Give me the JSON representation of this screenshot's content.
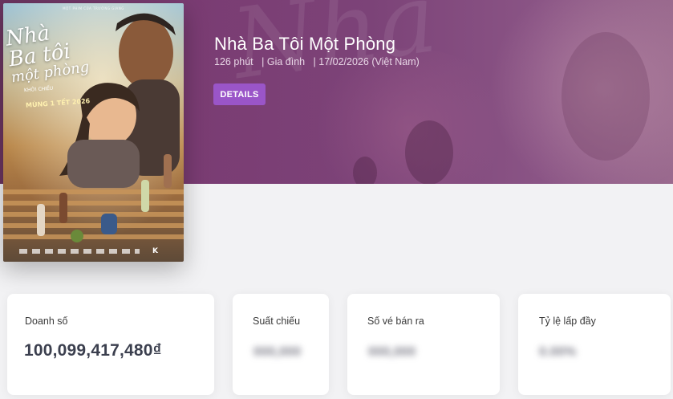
{
  "movie": {
    "title": "Nhà Ba Tôi Một Phòng",
    "duration": "126 phút",
    "genre": "Gia đình",
    "release": "17/02/2026 (Việt Nam)",
    "details_label": "DETAILS"
  },
  "poster": {
    "title_line1": "Nhà",
    "title_line2": "Ba tôi",
    "title_line3": "một phòng",
    "credits": "MỘT PHIM CỦA TRƯỜNG GIANG",
    "subtitle": "KHỞI CHIẾU",
    "date": "MÙNG 1 TẾT 2026",
    "logo": "K"
  },
  "stats": [
    {
      "label": "Doanh số",
      "value": "100,099,417,480₫"
    },
    {
      "label": "Suất chiếu",
      "value": "000,000"
    },
    {
      "label": "Số vé bán ra",
      "value": "000,000"
    },
    {
      "label": "Tỷ lệ lấp đầy",
      "value": "0.00%"
    }
  ],
  "colors": {
    "banner": "#7a3b72",
    "button": "#9a55c8",
    "card_bg": "#ffffff",
    "page_bg": "#f2f2f4"
  }
}
